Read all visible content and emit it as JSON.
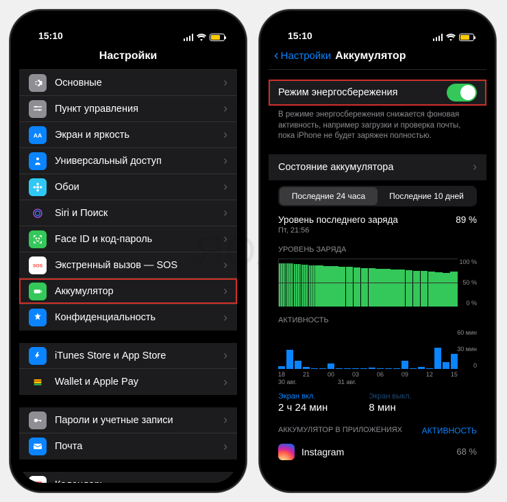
{
  "status": {
    "time": "15:10"
  },
  "left": {
    "title": "Настройки",
    "groups": [
      [
        {
          "icon": "gear",
          "bg": "#8e8e93",
          "label": "Основные"
        },
        {
          "icon": "sliders",
          "bg": "#8e8e93",
          "label": "Пункт управления"
        },
        {
          "icon": "aa",
          "bg": "#0a84ff",
          "label": "Экран и яркость"
        },
        {
          "icon": "person",
          "bg": "#0a84ff",
          "label": "Универсальный доступ"
        },
        {
          "icon": "flower",
          "bg": "#30c8f4",
          "label": "Обои"
        },
        {
          "icon": "siri",
          "bg": "#1c1c1e",
          "label": "Siri и Поиск"
        },
        {
          "icon": "faceid",
          "bg": "#34c759",
          "label": "Face ID и код-пароль"
        },
        {
          "icon": "sos",
          "bg": "#ffffff",
          "fg": "#ff3b30",
          "label": "Экстренный вызов — SOS"
        },
        {
          "icon": "battery",
          "bg": "#34c759",
          "label": "Аккумулятор",
          "hl": true
        },
        {
          "icon": "hand",
          "bg": "#0a84ff",
          "label": "Конфиденциальность"
        }
      ],
      [
        {
          "icon": "appstore",
          "bg": "#0a84ff",
          "label": "iTunes Store и App Store"
        },
        {
          "icon": "wallet",
          "bg": "#1c1c1e",
          "label": "Wallet и Apple Pay"
        }
      ],
      [
        {
          "icon": "key",
          "bg": "#8e8e93",
          "label": "Пароли и учетные записи"
        },
        {
          "icon": "mail",
          "bg": "#0a84ff",
          "label": "Почта"
        }
      ],
      [
        {
          "icon": "calendar",
          "bg": "#ffffff",
          "label": "Календарь"
        }
      ]
    ]
  },
  "right": {
    "back": "Настройки",
    "title": "Аккумулятор",
    "low_power_label": "Режим энергосбережения",
    "low_power_desc": "В режиме энергосбережения снижается фоновая активность, например загрузки и проверка почты, пока iPhone не будет заряжен полностью.",
    "battery_health_label": "Состояние аккумулятора",
    "seg_24h": "Последние 24 часа",
    "seg_10d": "Последние 10 дней",
    "last_charge_label": "Уровень последнего заряда",
    "last_charge_time": "Пт, 21:56",
    "last_charge_value": "89 %",
    "level_header": "УРОВЕНЬ ЗАРЯДА",
    "activity_header": "АКТИВНОСТЬ",
    "screen_on_label": "Экран вкл.",
    "screen_on_value": "2 ч 24 мин",
    "screen_off_label": "Экран выкл.",
    "screen_off_value": "8 мин",
    "apps_header": "АККУМУЛЯТОР В ПРИЛОЖЕНИЯХ",
    "show_activity": "АКТИВНОСТЬ",
    "app_name": "Instagram",
    "app_pct": "68 %"
  },
  "chart_data": {
    "battery_level": {
      "type": "bar",
      "ylim": [
        0,
        100
      ],
      "yticks": [
        "100 %",
        "50 %",
        "0 %"
      ],
      "values": [
        89,
        89,
        88,
        87,
        85,
        85,
        84,
        83,
        82,
        82,
        81,
        80,
        79,
        78,
        78,
        77,
        76,
        75,
        74,
        73,
        72,
        71,
        70,
        72
      ],
      "striped_indices": [
        0,
        1,
        2,
        3,
        4
      ]
    },
    "activity": {
      "type": "bar",
      "ylim": [
        0,
        60
      ],
      "yticks": [
        "60 мин",
        "30 мин",
        "0"
      ],
      "values": [
        4,
        28,
        12,
        3,
        1,
        1,
        8,
        0,
        0,
        0,
        1,
        2,
        0,
        0,
        0,
        12,
        1,
        3,
        0,
        32,
        10,
        22
      ],
      "xticks": [
        "18",
        "21",
        "00",
        "03",
        "06",
        "09",
        "12",
        "15"
      ],
      "dates": [
        "30 авг.",
        "31 авг."
      ]
    }
  }
}
